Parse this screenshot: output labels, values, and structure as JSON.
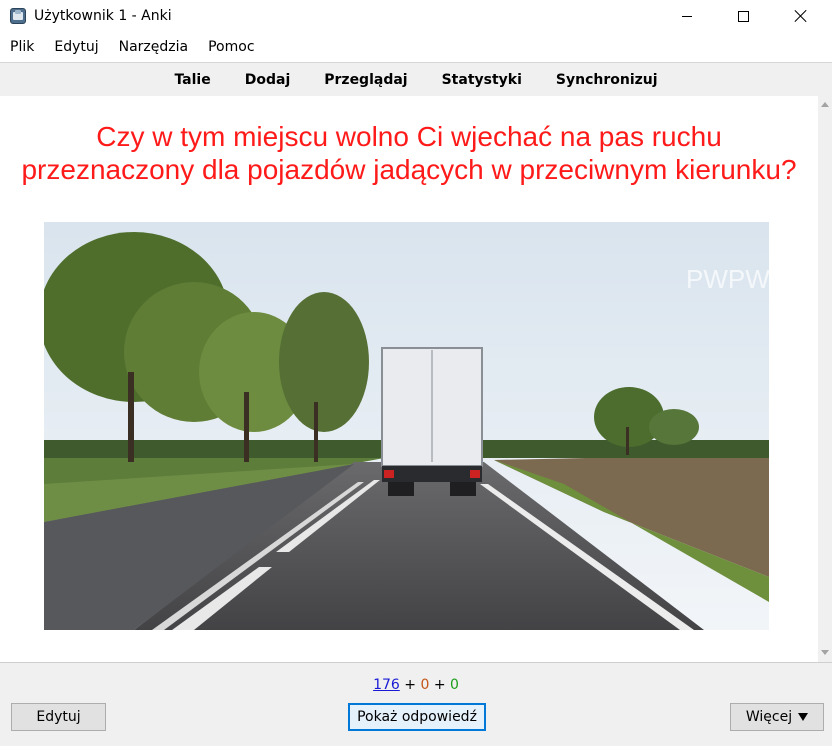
{
  "window": {
    "title": "Użytkownik 1 - Anki",
    "controls": [
      "minimize",
      "maximize",
      "close"
    ]
  },
  "menu": {
    "items": [
      {
        "label": "Plik"
      },
      {
        "label": "Edytuj"
      },
      {
        "label": "Narzędzia"
      },
      {
        "label": "Pomoc"
      }
    ]
  },
  "toolbar": {
    "links": [
      {
        "label": "Talie"
      },
      {
        "label": "Dodaj"
      },
      {
        "label": "Przeglądaj"
      },
      {
        "label": "Statystyki"
      },
      {
        "label": "Synchronizuj"
      }
    ]
  },
  "card": {
    "question": "Czy w tym miejscu wolno Ci wjechać na pas ruchu przeznaczony dla pojazdów jadących w przeciwnym kierunku?",
    "question_color": "#ff1a1a",
    "image": {
      "watermark": "PWPW",
      "icon": "road-truck-photo"
    }
  },
  "counts": {
    "new": "176",
    "plus1": "+",
    "learn": "0",
    "plus2": "+",
    "review": "0",
    "colors": {
      "new": "#1a1ad6",
      "learn": "#c35617",
      "review": "#1a9e1a"
    }
  },
  "bottom": {
    "edit_label": "Edytuj",
    "show_answer_label": "Pokaż odpowiedź",
    "more_label": "Więcej"
  }
}
